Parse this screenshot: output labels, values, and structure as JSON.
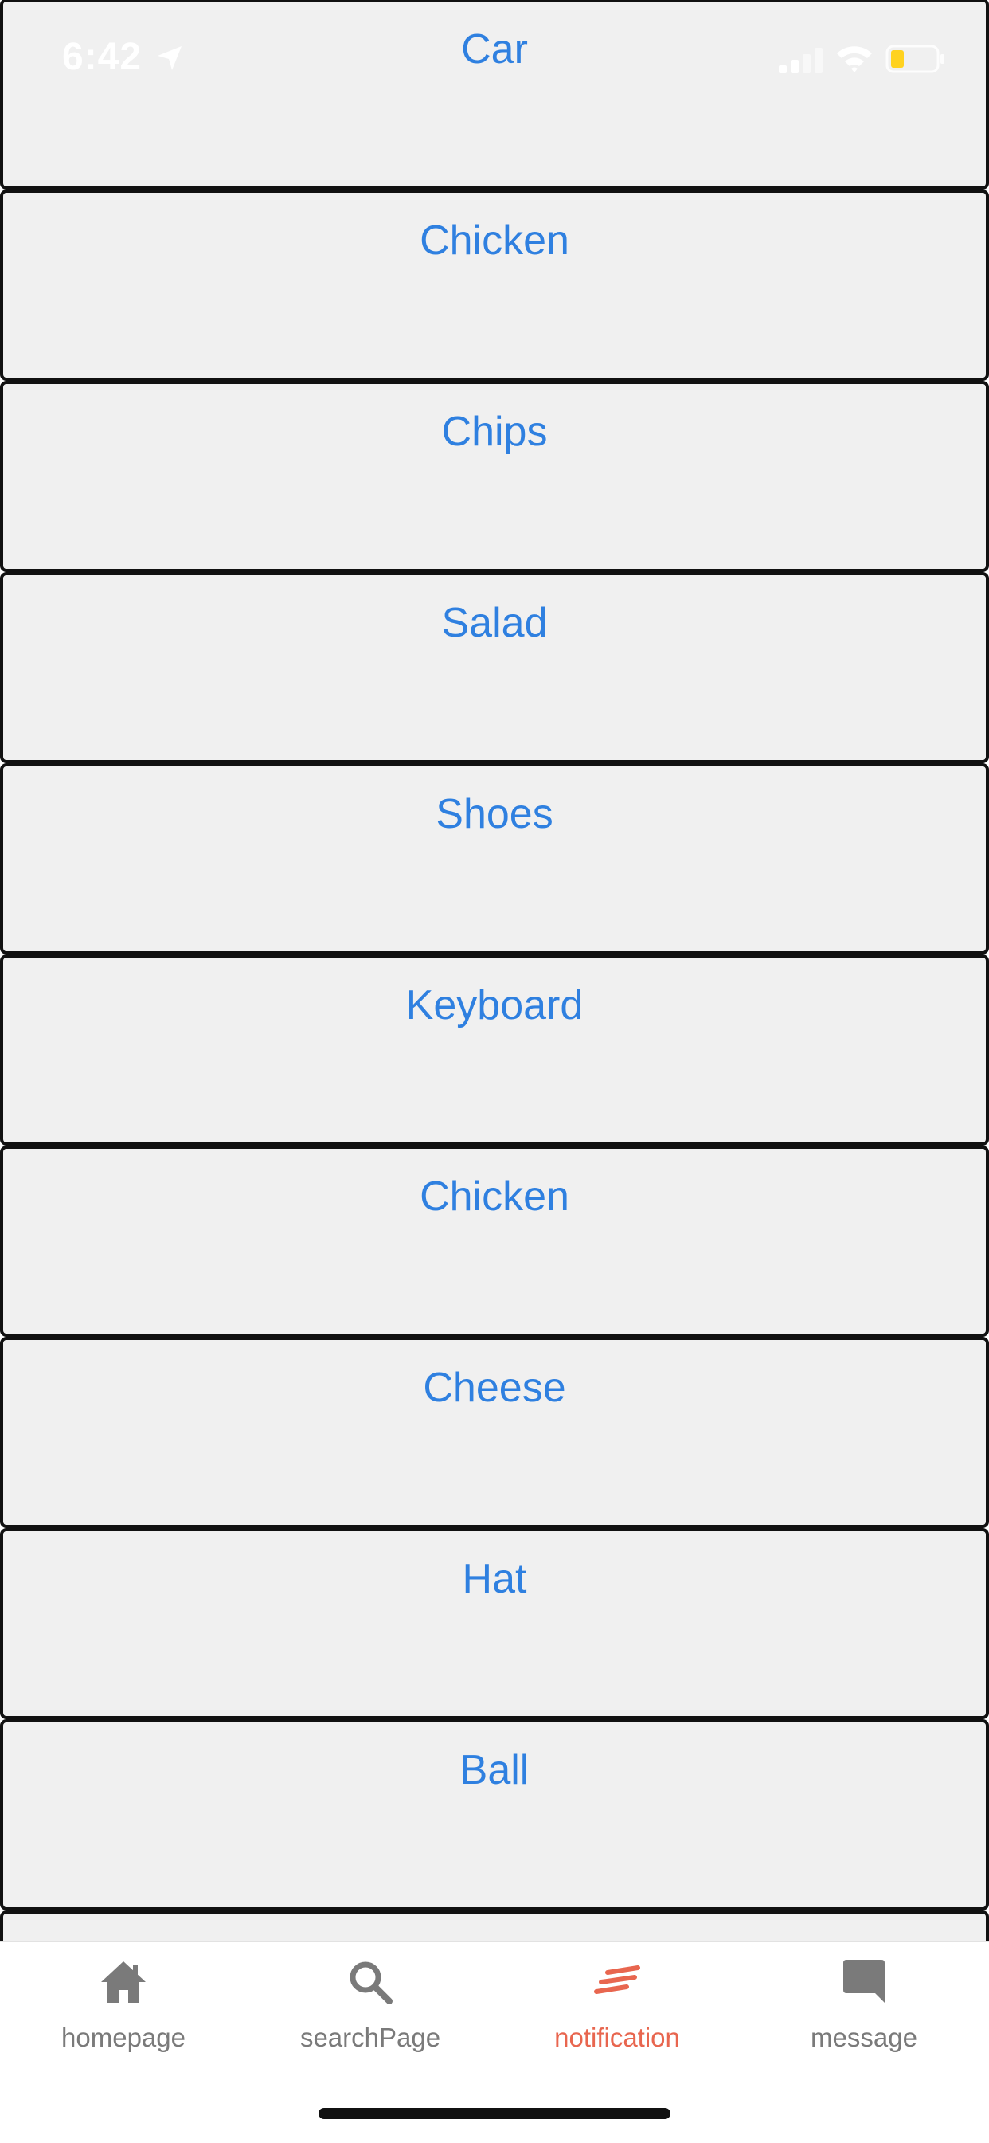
{
  "status_bar": {
    "time": "6:42"
  },
  "list": {
    "items": [
      {
        "label": "Car"
      },
      {
        "label": "Chicken"
      },
      {
        "label": "Chips"
      },
      {
        "label": "Salad"
      },
      {
        "label": "Shoes"
      },
      {
        "label": "Keyboard"
      },
      {
        "label": "Chicken"
      },
      {
        "label": "Cheese"
      },
      {
        "label": "Hat"
      },
      {
        "label": "Ball"
      },
      {
        "label": ""
      }
    ]
  },
  "tabbar": {
    "tabs": [
      {
        "label": "homepage",
        "icon": "home-icon",
        "active": false
      },
      {
        "label": "searchPage",
        "icon": "search-icon",
        "active": false
      },
      {
        "label": "notification",
        "icon": "notification-lines-icon",
        "active": true
      },
      {
        "label": "message",
        "icon": "message-icon",
        "active": false
      }
    ]
  },
  "colors": {
    "item_text": "#2f80e0",
    "card_background": "#f0f0f0",
    "card_border": "#111111",
    "tab_inactive": "#7a7a7a",
    "tab_active": "#e8664f"
  }
}
